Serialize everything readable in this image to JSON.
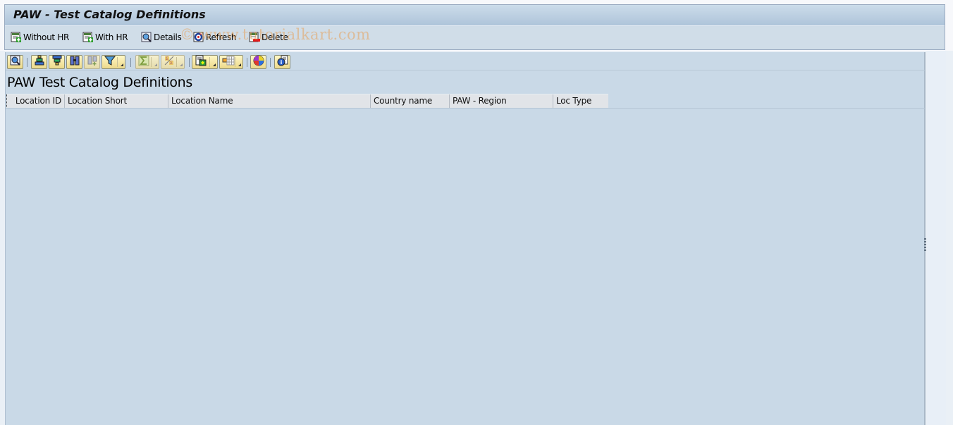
{
  "window": {
    "title": "PAW - Test Catalog Definitions"
  },
  "app_toolbar": {
    "buttons": [
      {
        "label": "Without HR",
        "icon": "create-icon"
      },
      {
        "label": "With HR",
        "icon": "create-icon"
      },
      {
        "label": "Details",
        "icon": "details-icon"
      },
      {
        "label": "Refresh",
        "icon": "refresh-icon"
      },
      {
        "label": "Delete",
        "icon": "delete-icon"
      }
    ]
  },
  "watermark": "© www.tutorialkart.com",
  "alv_toolbar": {
    "buttons": [
      {
        "name": "details",
        "icon": "magnifier-icon"
      },
      {
        "name": "sort-ascending",
        "icon": "sort-ascending-icon"
      },
      {
        "name": "sort-descending",
        "icon": "sort-descending-icon"
      },
      {
        "name": "find",
        "icon": "binoculars-icon"
      },
      {
        "name": "find-next",
        "icon": "find-next-icon",
        "disabled": true
      },
      {
        "name": "filter",
        "icon": "filter-icon",
        "dropdown": true
      },
      {
        "name": "total",
        "icon": "sigma-icon",
        "dropdown": true,
        "disabled": true
      },
      {
        "name": "subtotals",
        "icon": "subtotal-icon",
        "dropdown": true,
        "disabled": true
      },
      {
        "name": "export",
        "icon": "export-icon",
        "dropdown": true
      },
      {
        "name": "layout",
        "icon": "layout-icon",
        "dropdown": true
      },
      {
        "name": "graphic",
        "icon": "chart-icon"
      },
      {
        "name": "info",
        "icon": "info-icon"
      }
    ]
  },
  "list": {
    "title": "PAW Test Catalog Definitions",
    "columns": [
      "Location ID",
      "Location Short",
      "Location Name",
      "Country name",
      "PAW - Region",
      "Loc Type"
    ],
    "rows": []
  },
  "colors": {
    "content_bg": "#c9d9e7",
    "title_bar": "#aec4da",
    "button_bg": "#fff7c6"
  }
}
